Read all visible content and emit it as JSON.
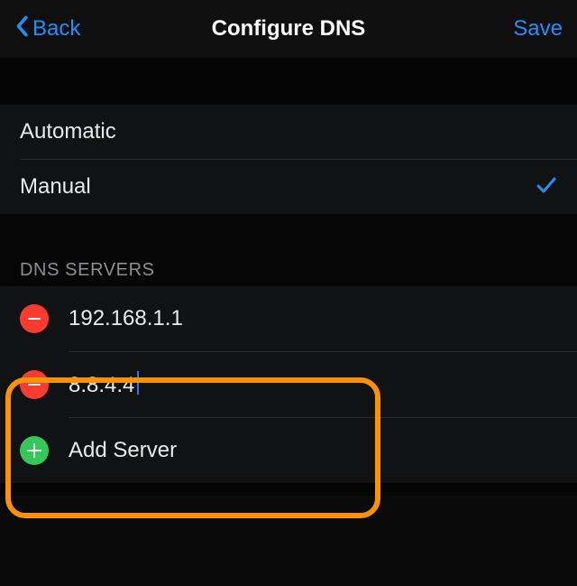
{
  "nav": {
    "back_label": "Back",
    "title": "Configure DNS",
    "save_label": "Save"
  },
  "modes": {
    "automatic_label": "Automatic",
    "manual_label": "Manual",
    "selected": "manual",
    "check_icon": "check-icon"
  },
  "servers": {
    "header": "DNS SERVERS",
    "items": [
      {
        "value": "192.168.1.1",
        "editing": false
      },
      {
        "value": "8.8.4.4",
        "editing": true
      }
    ],
    "add_label": "Add Server"
  },
  "icons": {
    "back": "chevron-left-icon",
    "remove": "minus-icon",
    "add": "plus-icon"
  },
  "colors": {
    "accent": "#248dfd",
    "remove": "#ff3b30",
    "add": "#34c759",
    "highlight": "#fb9200"
  }
}
